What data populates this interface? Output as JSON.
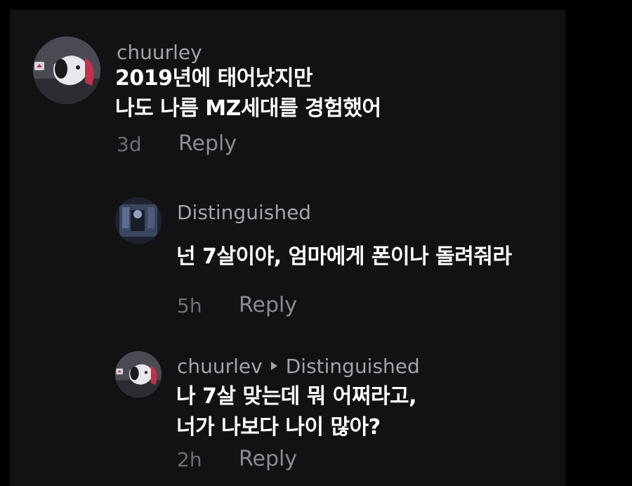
{
  "comments": [
    {
      "username": "chuurley",
      "lines": [
        "2019년에 태어났지만",
        "나도 나름 MZ세대를 경험했어"
      ],
      "time": "3d",
      "reply_label": "Reply",
      "avatar_icon": "snoopy-avatar-icon"
    },
    {
      "username": "Distinguished",
      "lines": [
        "넌 7살이야, 엄마에게 폰이나 돌려줘라"
      ],
      "time": "5h",
      "reply_label": "Reply",
      "avatar_icon": "dark-photo-avatar-icon"
    },
    {
      "username": "chuurlev",
      "reply_to": "Distinguished",
      "lines": [
        "나 7살 맞는데 뭐 어쩌라고,",
        "너가 나보다 나이 많아?"
      ],
      "time": "2h",
      "reply_label": "Reply",
      "avatar_icon": "snoopy-avatar-icon"
    }
  ],
  "colors": {
    "background": "#000000",
    "panel": "#121215",
    "username": "#a3a3aa",
    "body_text": "#ffffff",
    "meta": "#6f6f76"
  }
}
